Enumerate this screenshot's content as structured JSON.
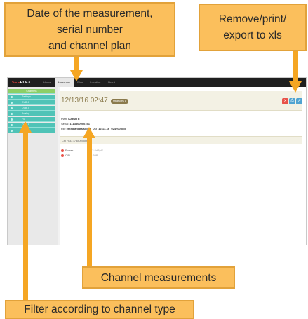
{
  "callouts": {
    "date": [
      "Date of the measurement,",
      "serial number",
      "and channel plan"
    ],
    "remove": [
      "Remove/print/",
      "export to xls"
    ],
    "channels": "Channel measurements",
    "filter": "Filter according to channel type"
  },
  "app": {
    "logo_prefix": "SEE",
    "logo_suffix": "PLEX",
    "nav": [
      "Home",
      "Measures",
      "Plan",
      "Location",
      "About"
    ],
    "sidebar": {
      "header": "Channels",
      "items": [
        "Settings",
        "DVB-C",
        "DVB-T",
        "Analog",
        "FM",
        "DVB-S",
        "Others"
      ]
    },
    "measurement": {
      "date": "12/13/16 02:47",
      "badge": "Measures 1",
      "plan_label": "Plan:",
      "plan": "KABATE",
      "serial_label": "Serial:",
      "serial": "1113300000161",
      "file_label": "File:",
      "file": "/media/data/seg/A_DG_12-13-16_024700.log",
      "actions": {
        "remove": "x",
        "print": "⎙",
        "export": "↗"
      },
      "channel_header": "CH H 33  (738000kHz)",
      "rows": [
        {
          "label": "Power",
          "value": "33.8dBµV"
        },
        {
          "label": "C/N",
          "value": "> 5dB"
        }
      ]
    }
  },
  "colors": {
    "callout": "#fbbf5c",
    "arrow": "#f5a623",
    "filter_item": "#4fc3b7",
    "filter_header": "#8ccf67",
    "remove_button": "#e8534a",
    "action_button": "#4fa3d1"
  },
  "icons": [
    "arrow-up-icon",
    "arrow-down-icon",
    "close-icon",
    "print-icon",
    "export-icon"
  ]
}
